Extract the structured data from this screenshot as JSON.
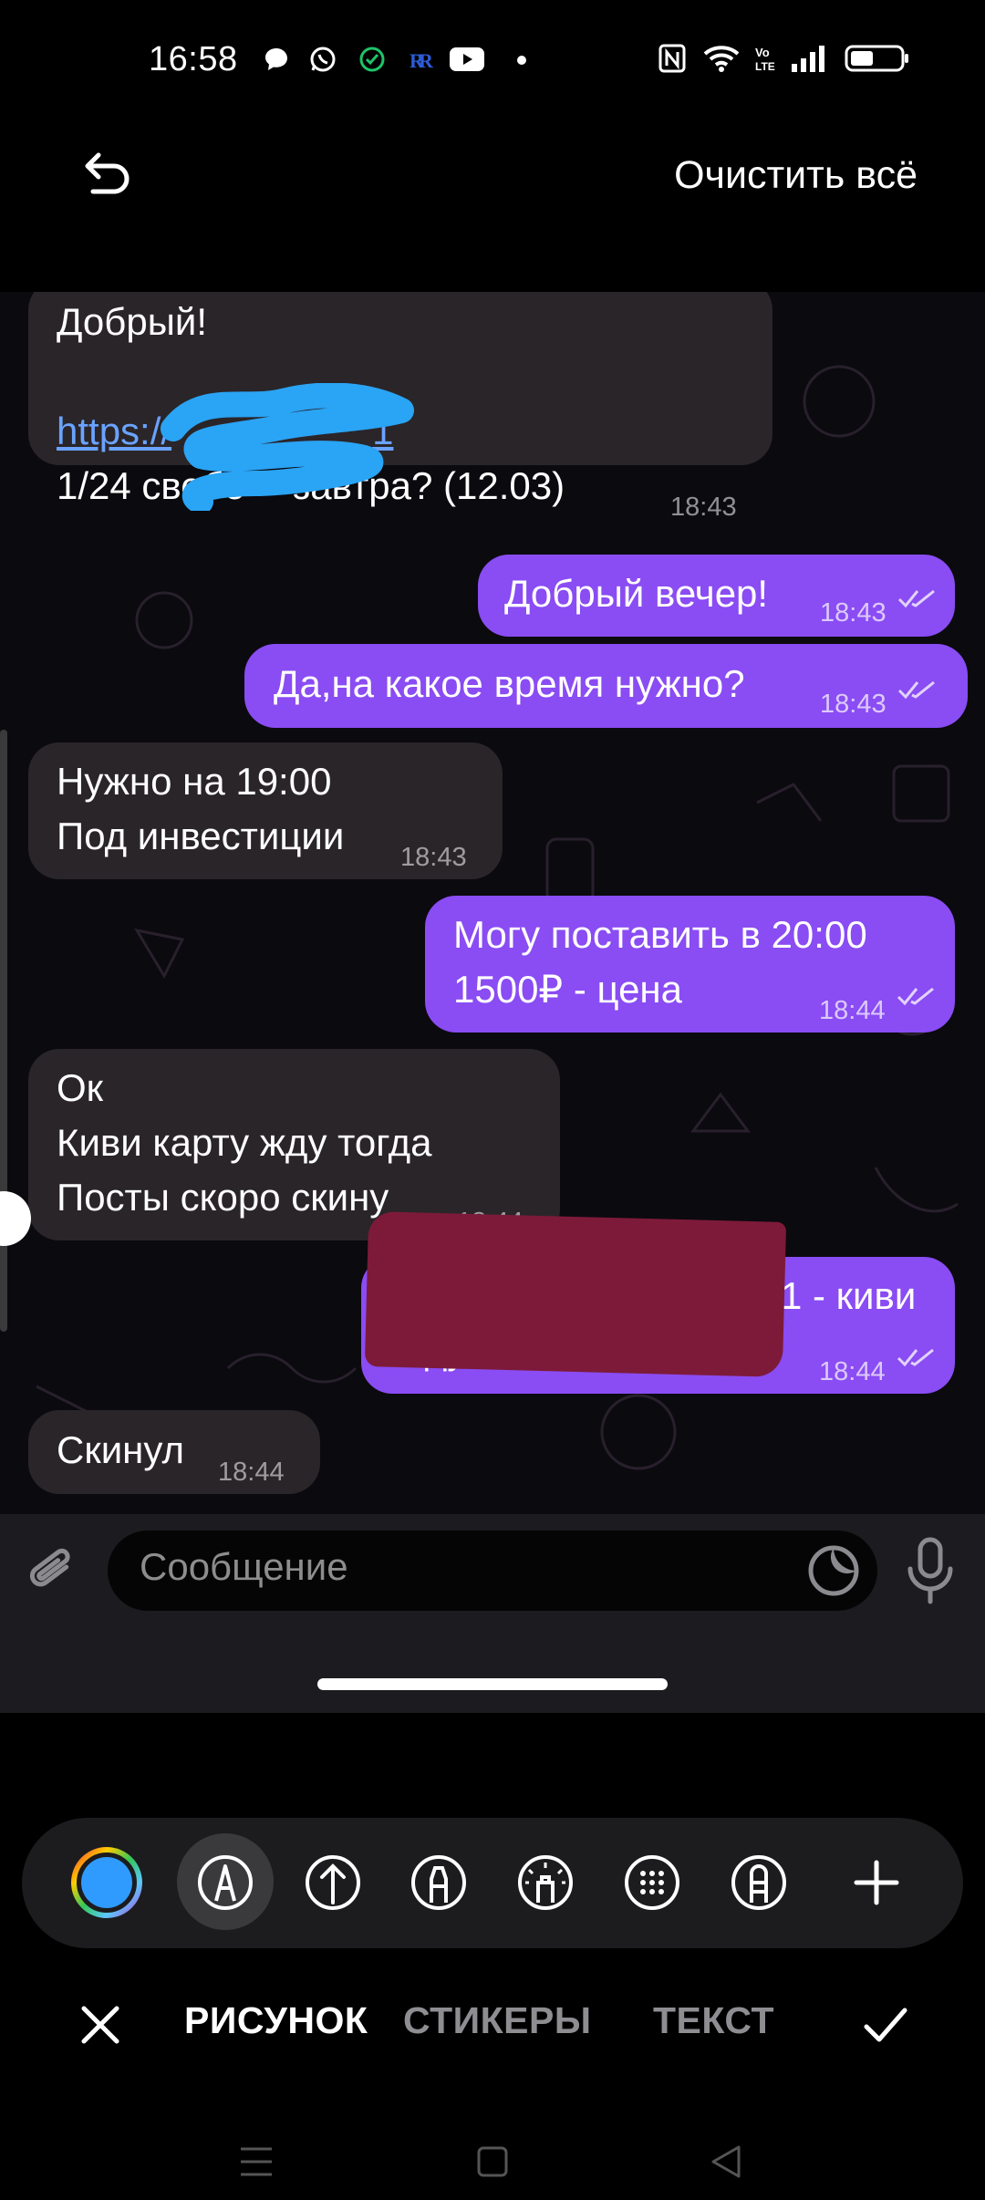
{
  "status_bar": {
    "time": "16:58",
    "icons": [
      "chat-bubble-icon",
      "whatsapp-icon",
      "check-circle-icon",
      "r-app-icon",
      "youtube-icon",
      "dot-icon",
      "nfc-icon",
      "wifi-icon",
      "volte-icon",
      "signal-icon",
      "battery-icon"
    ]
  },
  "editor_header": {
    "clear_all_label": "Очистить всё"
  },
  "chat": {
    "messages": [
      {
        "side": "in",
        "lines": [
          "Добрый!",
          "",
          "https://",
          "1/24 свобо",
          "завтра? (12.03)"
        ],
        "link_visible_tail": "1",
        "time": "18:43"
      },
      {
        "side": "out",
        "text": "Добрый вечер!",
        "time": "18:43"
      },
      {
        "side": "out",
        "text": "Да,на какое время нужно?",
        "time": "18:43"
      },
      {
        "side": "in",
        "lines": [
          "Нужно на 19:00",
          "Под инвестиции"
        ],
        "time": "18:43"
      },
      {
        "side": "out",
        "lines": [
          "Могу поставить в 20:00",
          "1500₽ - цена"
        ],
        "time": "18:44"
      },
      {
        "side": "in",
        "lines": [
          "Ок",
          "Киви карту жду тогда",
          "Посты скоро скину"
        ],
        "time": "18:44"
      },
      {
        "side": "out",
        "lines": [
          "1 - киви",
          "Жду оплату"
        ],
        "time": "18:44"
      },
      {
        "side": "in",
        "text": "Скинул",
        "time": "18:44"
      }
    ]
  },
  "input_bar": {
    "placeholder": "Сообщение"
  },
  "toolbar": {
    "tools": [
      "color-picker",
      "pen",
      "arrow",
      "marker",
      "neon",
      "blur",
      "eraser",
      "add"
    ],
    "selected_tool": "pen",
    "selected_color": "#2f9bff"
  },
  "tabs": {
    "draw": "РИСУНОК",
    "stickers": "СТИКЕРЫ",
    "text": "ТЕКСТ",
    "active": "draw"
  },
  "colors": {
    "outgoing_bubble": "#8a4cf3",
    "incoming_bubble": "#2a2529",
    "blue_scribble": "#2aa4f4",
    "red_scribble": "#7d1a3a"
  }
}
